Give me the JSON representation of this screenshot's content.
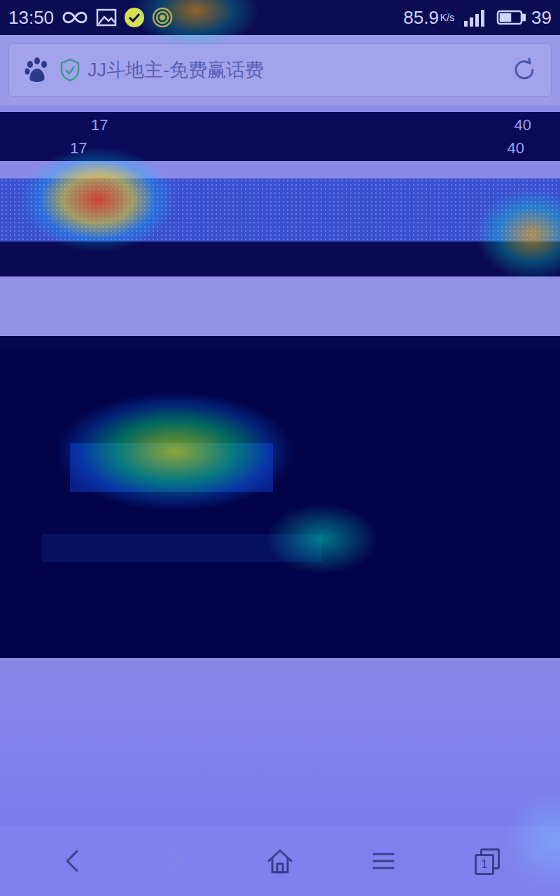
{
  "status_bar": {
    "time": "13:50",
    "speed": "85.9",
    "speed_unit": "K/s",
    "battery": "39"
  },
  "address_bar": {
    "title": "JJ斗地主-免费赢话费"
  },
  "page": {
    "fragments": [
      {
        "text": "17"
      },
      {
        "text": "17"
      },
      {
        "text": "40"
      },
      {
        "text": "40"
      }
    ]
  },
  "bottom_nav": {
    "items": [
      {
        "name": "back",
        "disabled": false
      },
      {
        "name": "forward",
        "disabled": true
      },
      {
        "name": "home",
        "disabled": false
      },
      {
        "name": "menu",
        "disabled": false
      },
      {
        "name": "tabs",
        "disabled": false
      }
    ],
    "tab_count": "1"
  }
}
